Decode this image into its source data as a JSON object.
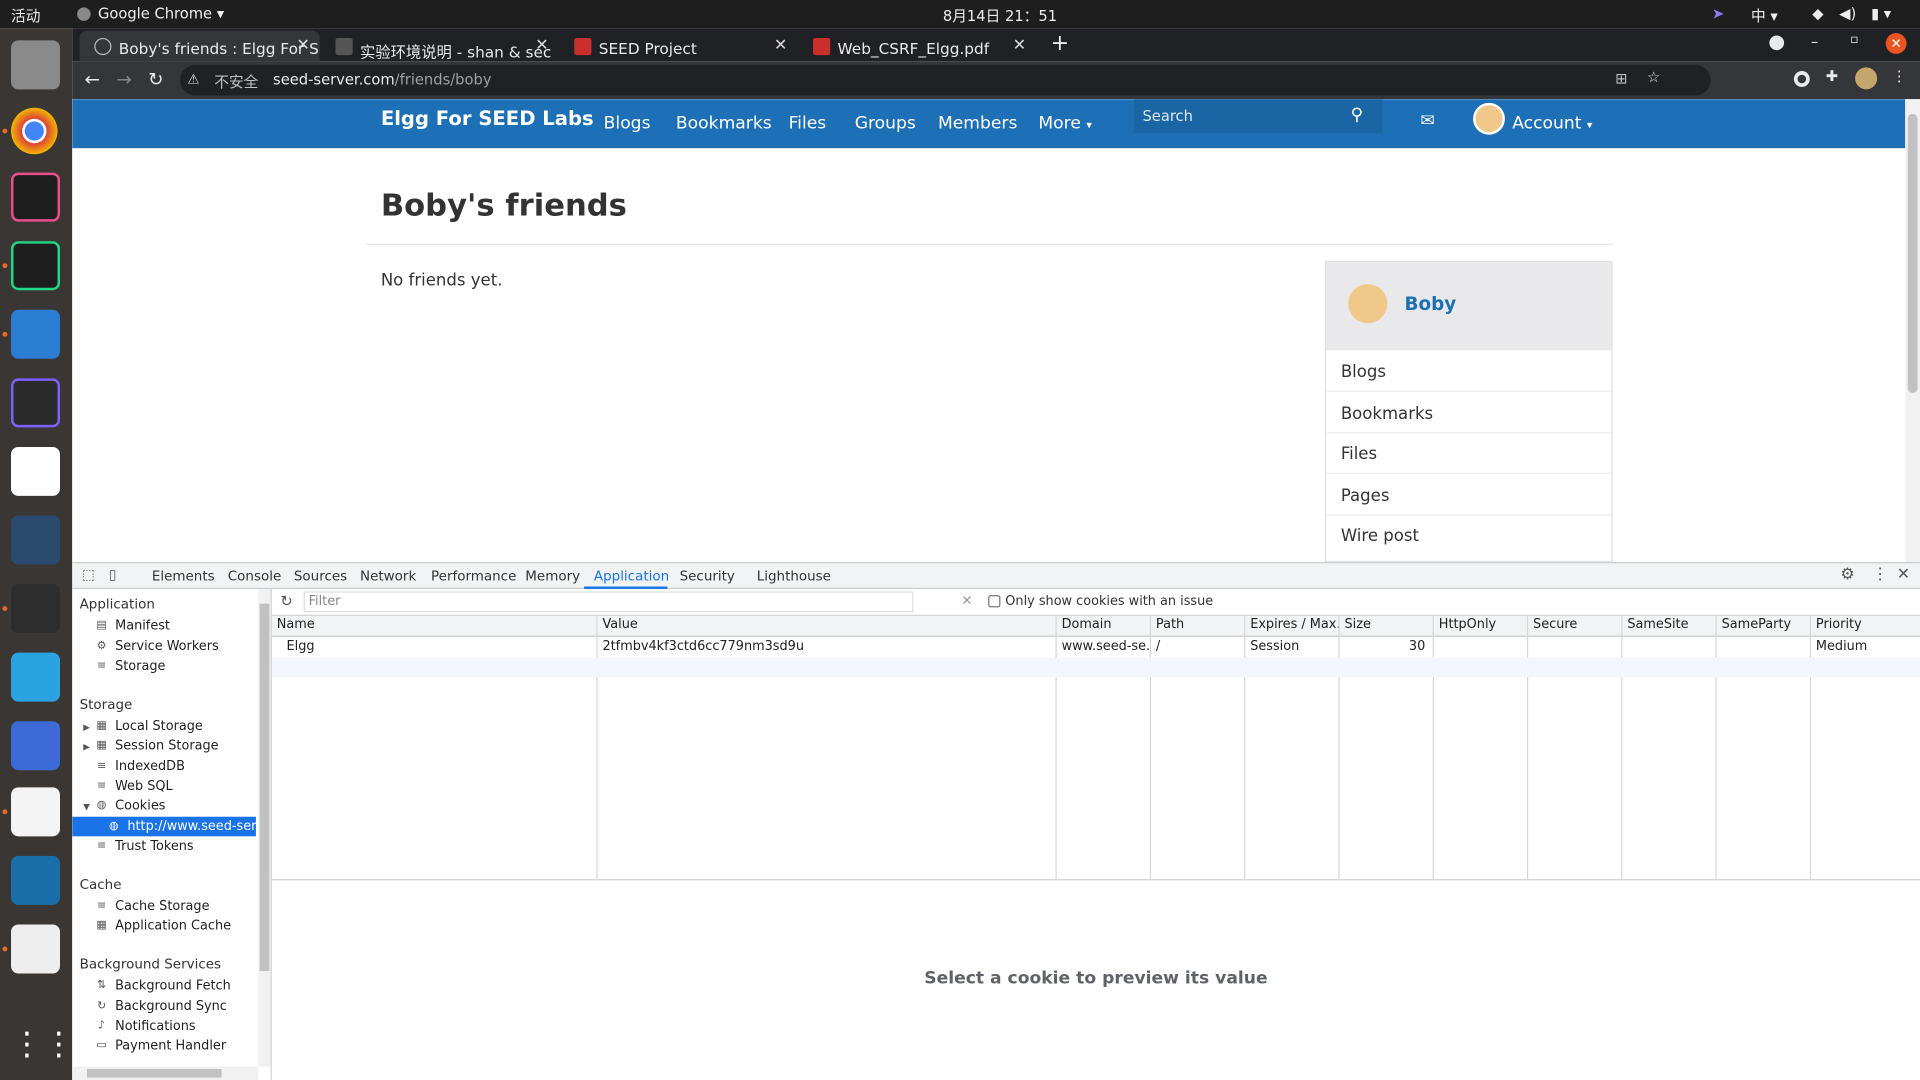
{
  "os_bar": {
    "activities": "活动",
    "app": "Google Chrome",
    "clock": "8月14日  21：51",
    "input_method": "中"
  },
  "tabs": [
    {
      "title": "Boby's friends : Elgg For S",
      "active": true
    },
    {
      "title": "实验环境说明 - shan & sec",
      "active": false
    },
    {
      "title": "SEED Project",
      "active": false
    },
    {
      "title": "Web_CSRF_Elgg.pdf",
      "active": false
    }
  ],
  "address": {
    "security": "不安全",
    "host": "seed-server.com",
    "path": "/friends/boby"
  },
  "site": {
    "brand": "Elgg For SEED Labs",
    "nav": [
      "Blogs",
      "Bookmarks",
      "Files",
      "Groups",
      "Members",
      "More"
    ],
    "search_placeholder": "Search",
    "account": "Account",
    "heading": "Boby's friends",
    "empty": "No friends yet.",
    "profile_name": "Boby",
    "owner_menu": [
      "Blogs",
      "Bookmarks",
      "Files",
      "Pages",
      "Wire post"
    ]
  },
  "devtools": {
    "tabs": [
      "Elements",
      "Console",
      "Sources",
      "Network",
      "Performance",
      "Memory",
      "Application",
      "Security",
      "Lighthouse"
    ],
    "active_tab": "Application",
    "sidebar": {
      "application_title": "Application",
      "application_items": [
        "Manifest",
        "Service Workers",
        "Storage"
      ],
      "storage_title": "Storage",
      "storage_items": [
        "Local Storage",
        "Session Storage",
        "IndexedDB",
        "Web SQL",
        "Cookies"
      ],
      "cookie_origin": "http://www.seed-server",
      "trust_tokens": "Trust Tokens",
      "cache_title": "Cache",
      "cache_items": [
        "Cache Storage",
        "Application Cache"
      ],
      "bg_title": "Background Services",
      "bg_items": [
        "Background Fetch",
        "Background Sync",
        "Notifications",
        "Payment Handler"
      ]
    },
    "filter_placeholder": "Filter",
    "only_issue_label": "Only show cookies with an issue",
    "columns": [
      "Name",
      "Value",
      "Domain",
      "Path",
      "Expires / Max...",
      "Size",
      "HttpOnly",
      "Secure",
      "SameSite",
      "SameParty",
      "Priority"
    ],
    "row": {
      "name": "Elgg",
      "value": "2tfmbv4kf3ctd6cc779nm3sd9u",
      "domain": "www.seed-se...",
      "path": "/",
      "expires": "Session",
      "size": "30",
      "priority": "Medium"
    },
    "preview_text": "Select a cookie to preview its value"
  },
  "colors": {
    "accent": "#1d70b5",
    "devtools_selected": "#1a73e8"
  }
}
